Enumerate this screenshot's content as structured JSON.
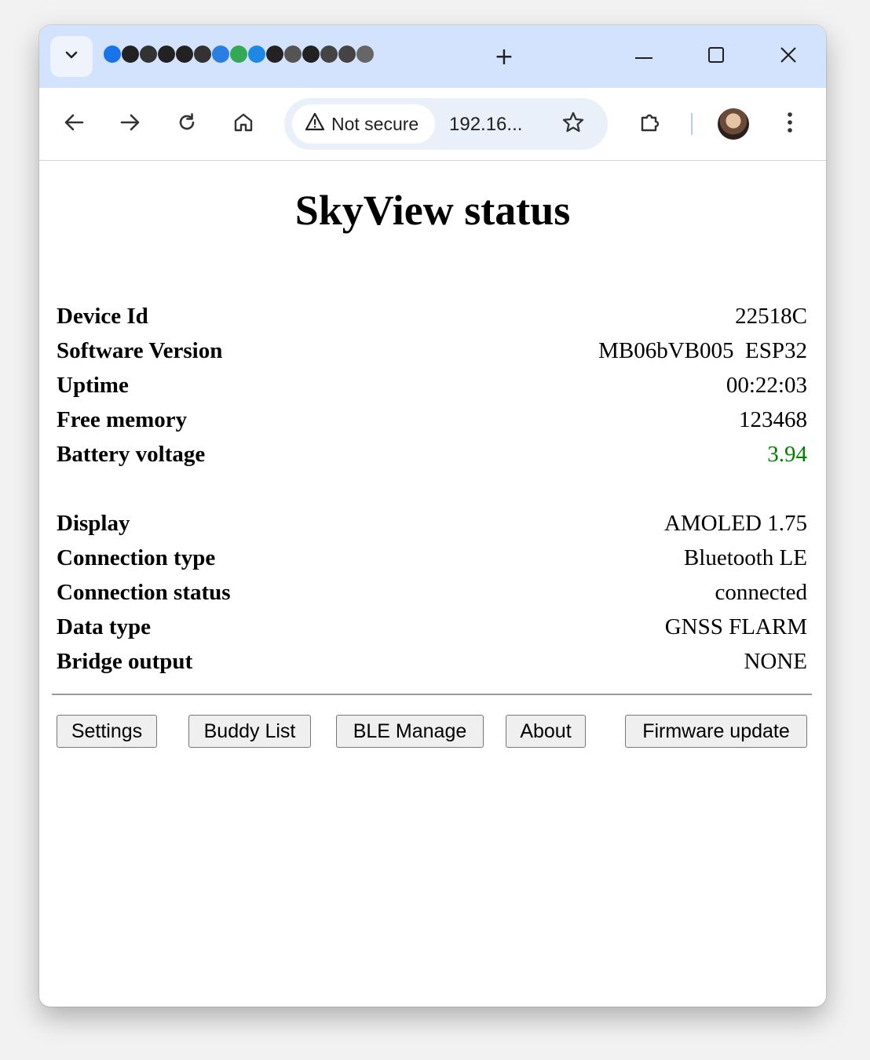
{
  "browser": {
    "new_tab_label": "+",
    "security_label": "Not secure",
    "url": "192.16...",
    "favicon_colors": [
      "#1a73e8",
      "#222222",
      "#333333",
      "#222222",
      "#222222",
      "#333333",
      "#2a7de1",
      "#34a853",
      "#1e88e5",
      "#222222",
      "#555555",
      "#222222",
      "#444444",
      "#444444",
      "#666666"
    ]
  },
  "page": {
    "title": "SkyView status",
    "status_rows": [
      {
        "label": "Device Id",
        "value": "22518C"
      },
      {
        "label": "Software Version",
        "value": "MB06bVB005  ESP32"
      },
      {
        "label": "Uptime",
        "value": "00:22:03"
      },
      {
        "label": "Free memory",
        "value": "123468"
      },
      {
        "label": "Battery voltage",
        "value": "3.94",
        "value_color": "#008000"
      }
    ],
    "display_rows": [
      {
        "label": "Display",
        "value": "AMOLED 1.75"
      },
      {
        "label": "Connection type",
        "value": "Bluetooth LE"
      },
      {
        "label": "Connection status",
        "value": "connected"
      },
      {
        "label": "Data type",
        "value": "GNSS FLARM"
      },
      {
        "label": "Bridge output",
        "value": "NONE"
      }
    ],
    "buttons": {
      "settings": "Settings",
      "buddy_list": "Buddy List",
      "ble_manage": "BLE Manage",
      "about": "About",
      "firmware_update": "Firmware update"
    }
  }
}
